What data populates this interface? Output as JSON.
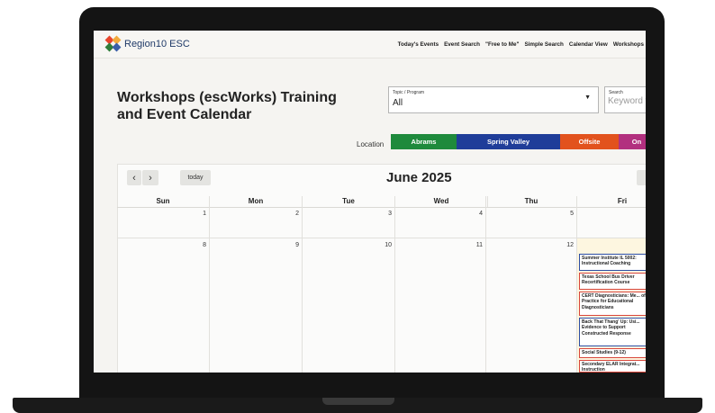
{
  "brand": {
    "name": "Region10 ESC",
    "colors": [
      "#e8452c",
      "#f2a93b",
      "#2f7d3a",
      "#3a5fa8"
    ]
  },
  "nav": {
    "items": [
      "Today's Events",
      "Event Search",
      "\"Free to Me\"",
      "Simple Search",
      "Calendar View",
      "Workshops"
    ]
  },
  "page": {
    "title": "Workshops (escWorks) Training and Event Calendar"
  },
  "filters": {
    "topic_label": "Topic / Program",
    "topic_value": "All",
    "search_label": "Search",
    "search_placeholder": "Keyword fi"
  },
  "location": {
    "label": "Location",
    "options": [
      {
        "label": "Abrams",
        "color": "#1e8a3c"
      },
      {
        "label": "Spring Valley",
        "color": "#1f3d99"
      },
      {
        "label": "Offsite",
        "color": "#e2521d"
      },
      {
        "label": "On",
        "color": "#b2307f"
      }
    ]
  },
  "calendar": {
    "month_title": "June 2025",
    "prev_icon": "‹",
    "next_icon": "›",
    "today_label": "today",
    "days": [
      "Sun",
      "Mon",
      "Tue",
      "Wed",
      "Thu",
      "Fri"
    ],
    "week1": [
      "1",
      "2",
      "3",
      "4",
      "5"
    ],
    "week2": [
      "8",
      "9",
      "10",
      "11",
      "12"
    ],
    "events": [
      {
        "title": "Summer Institute IL 5002: Instructional Coaching",
        "color": "#2d4ea3"
      },
      {
        "title": "Texas School Bus Driver Recertification Course",
        "color": "#d8463a"
      },
      {
        "title": "CERT Diagnosticians: Me... of Practice for Educational Diagnosticians",
        "color": "#d8463a"
      },
      {
        "title": "Back That Thang' Up: Usi... Evidence to Support Constructed Response",
        "color": "#2d4ea3"
      },
      {
        "title": "Social Studies (9-12)",
        "color": "#d8463a"
      },
      {
        "title": "Secondary ELAR Integrat... Instruction",
        "color": "#d8463a"
      }
    ]
  }
}
